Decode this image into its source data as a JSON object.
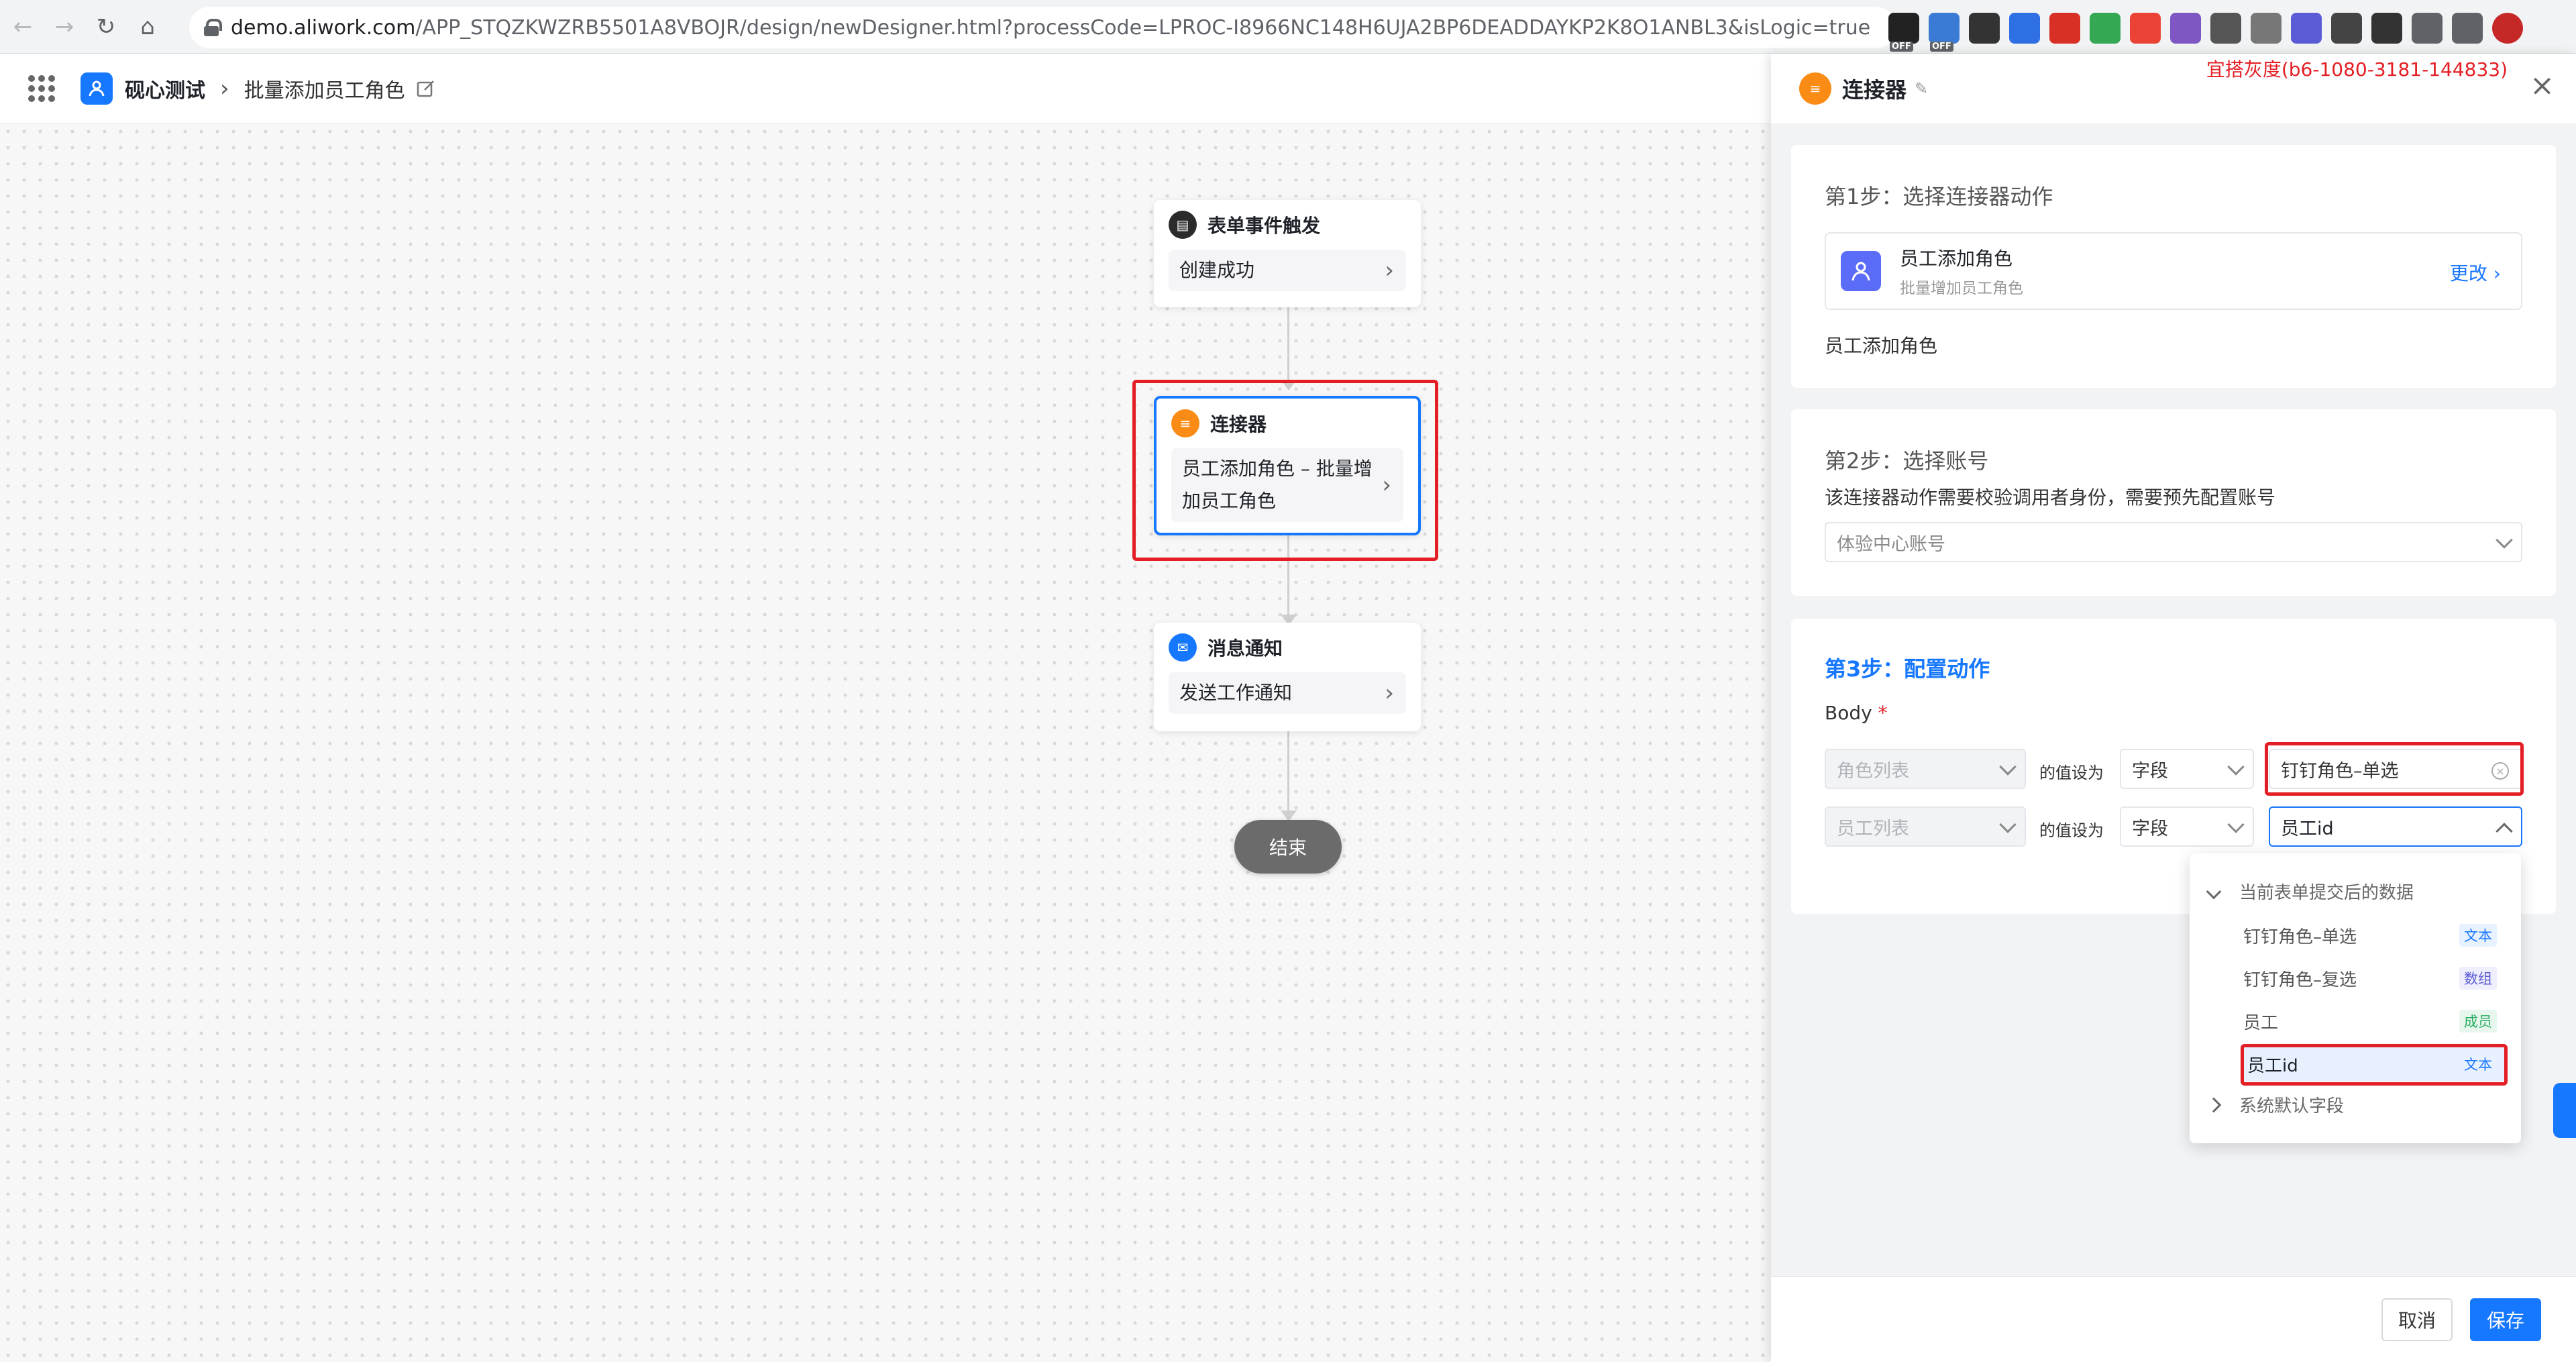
{
  "browser": {
    "url_host": "demo.aliwork.com",
    "url_path": "/APP_STQZKWZRB5501A8VBOJR/design/newDesigner.html?processCode=LPROC-I8966NC148H6UJA2BP6DEADDAYKP2K8O1ANBL3&isLogic=true",
    "ext_off_label": "OFF"
  },
  "header": {
    "app_name": "砚心测试",
    "page_name": "批量添加员工角色"
  },
  "flow": {
    "trigger": {
      "title": "表单事件触发",
      "body": "创建成功"
    },
    "connector": {
      "title": "连接器",
      "body_line1": "员工添加角色 – 批量增",
      "body_line2": "加员工角色"
    },
    "notify": {
      "title": "消息通知",
      "body": "发送工作通知"
    },
    "end_label": "结束"
  },
  "panel": {
    "title": "连接器",
    "env_tag": "宜搭灰度(b6-1080-3181-144833)",
    "step1": {
      "title": "第1步：选择连接器动作",
      "connector_name": "员工添加角色",
      "connector_desc": "批量增加员工角色",
      "change_label": "更改",
      "action_name": "员工添加角色"
    },
    "step2": {
      "title": "第2步：选择账号",
      "hint": "该连接器动作需要校验调用者身份，需要预先配置账号",
      "account": "体验中心账号"
    },
    "step3": {
      "title": "第3步：配置动作",
      "body_label": "Body",
      "required_mark": "*",
      "rows": [
        {
          "param": "角色列表",
          "value_as": "的值设为",
          "type": "字段",
          "value": "钉钉角色–单选"
        },
        {
          "param": "员工列表",
          "value_as": "的值设为",
          "type": "字段",
          "value": "员工id"
        }
      ]
    },
    "dropdown": {
      "group_current": "当前表单提交后的数据",
      "items": [
        {
          "label": "钉钉角色–单选",
          "tag": "文本"
        },
        {
          "label": "钉钉角色–复选",
          "tag": "数组"
        },
        {
          "label": "员工",
          "tag": "成员"
        },
        {
          "label": "员工id",
          "tag": "文本"
        }
      ],
      "group_system": "系统默认字段"
    },
    "footer": {
      "cancel": "取消",
      "save": "保存"
    }
  },
  "colors": {
    "primary": "#1677ff",
    "highlight_red": "#e31e24",
    "connector_orange": "#fa8c16"
  }
}
